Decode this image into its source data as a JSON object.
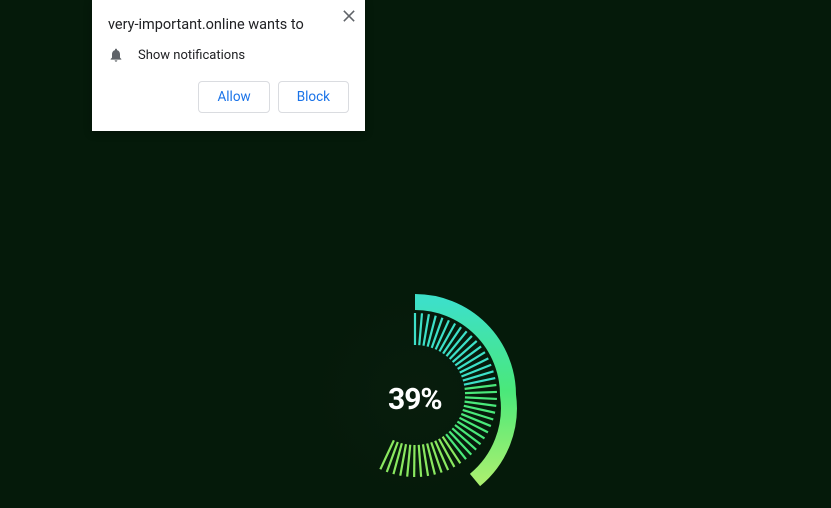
{
  "popup": {
    "title": "very-important.online wants to",
    "permission": "Show notifications",
    "allow_label": "Allow",
    "block_label": "Block"
  },
  "loader": {
    "percent_text": "39%",
    "percent_value": 39
  }
}
